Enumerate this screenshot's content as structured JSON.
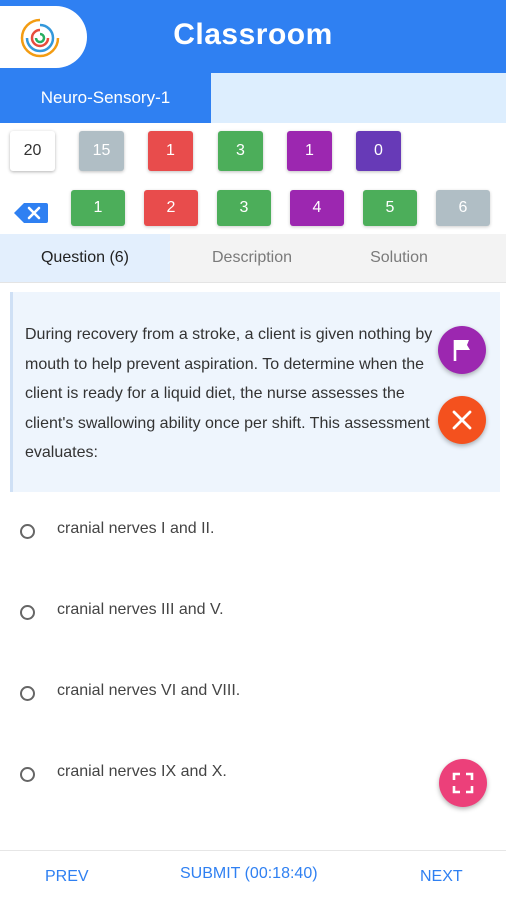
{
  "header": {
    "title": "Classroom"
  },
  "subtabs": {
    "active": "Neuro-Sensory-1"
  },
  "stats": [
    {
      "value": "20",
      "color": "#ffffff"
    },
    {
      "value": "15",
      "color": "#b0bec5"
    },
    {
      "value": "1",
      "color": "#e84c4c"
    },
    {
      "value": "3",
      "color": "#4cae5a"
    },
    {
      "value": "1",
      "color": "#9c27b0"
    },
    {
      "value": "0",
      "color": "#673ab7"
    }
  ],
  "question_numbers": [
    {
      "value": "1",
      "color": "#4cae5a"
    },
    {
      "value": "2",
      "color": "#e84c4c"
    },
    {
      "value": "3",
      "color": "#4cae5a"
    },
    {
      "value": "4",
      "color": "#9c27b0"
    },
    {
      "value": "5",
      "color": "#4cae5a"
    },
    {
      "value": "6",
      "color": "#b0bec5"
    }
  ],
  "tabs": [
    "Question (6)",
    "Description",
    "Solution"
  ],
  "question": {
    "text": "During recovery from a stroke, a client is given nothing by mouth to help prevent aspiration. To determine when the client is ready for a liquid diet, the nurse assesses the client's swallowing ability once per shift. This assessment evaluates:"
  },
  "options": [
    "cranial nerves I and II.",
    "cranial nerves III and V.",
    "cranial nerves VI and VIII.",
    "cranial nerves IX and X."
  ],
  "footer": {
    "prev": "PREV",
    "submit": "SUBMIT (00:18:40)",
    "next": "NEXT"
  },
  "colors": {
    "primary": "#2f80f2",
    "flag_fab": "#9c27b0",
    "close_fab": "#f4511e",
    "fullscreen_fab": "#ec407a"
  },
  "icons": [
    "app-logo-icon",
    "backspace-icon",
    "flag-icon",
    "close-icon",
    "fullscreen-icon",
    "radio-icon"
  ]
}
